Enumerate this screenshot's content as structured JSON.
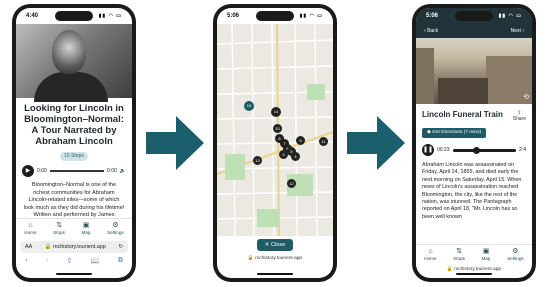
{
  "colors": {
    "brand_teal": "#1e5b66",
    "arrow_teal": "#1a5f6b",
    "dark_header": "#20343a"
  },
  "phone1": {
    "time": "4:40",
    "tour_title": "Looking for Lincoln in Bloomington–Normal: A Tour Narrated by Abraham Lincoln",
    "stops_badge": "15 Stops",
    "audio_start": "0:00",
    "audio_end": "0:00",
    "description": "Bloomington–Normal is one of the richest communities for Abraham Lincoln-related sites—some of which look much as they did during his lifetime! Written and performed by James Keeran.",
    "tabs": [
      {
        "label": "Home",
        "icon": "home-icon"
      },
      {
        "label": "Stops",
        "icon": "list-icon"
      },
      {
        "label": "Map",
        "icon": "map-icon"
      },
      {
        "label": "Settings",
        "icon": "gear-icon"
      }
    ],
    "text_size_label": "AA",
    "url": "mchistory.tourient.app"
  },
  "phone2": {
    "time": "5:06",
    "markers": [
      "15",
      "14",
      "10",
      "9",
      "8",
      "7",
      "6",
      "5",
      "4",
      "3",
      "11",
      "12",
      "13"
    ],
    "close_label": "Close",
    "url": "mchistory.tourient.app"
  },
  "phone3": {
    "time": "5:06",
    "back_label": "Back",
    "next_label": "Next",
    "title": "Lincoln Funeral Train",
    "share_label": "Share",
    "directions_label": "Get Directions (7 mins)",
    "audio_current": "00:23",
    "audio_total": "2:4",
    "progress": 0.32,
    "description": "Abraham Lincoln was assassinated on Friday, April 14, 1865, and died early the next morning on Saturday, April 15. When news of Lincoln's assassination reached Bloomington, the city, like the rest of the nation, was stunned. The Pantagraph reported on April 18, \"Mr. Lincoln has so been well known",
    "tabs": [
      {
        "label": "Home",
        "icon": "home-icon"
      },
      {
        "label": "Stops",
        "icon": "list-icon"
      },
      {
        "label": "Map",
        "icon": "map-icon"
      },
      {
        "label": "Settings",
        "icon": "gear-icon"
      }
    ],
    "url": "mchistory.tourient.app"
  }
}
